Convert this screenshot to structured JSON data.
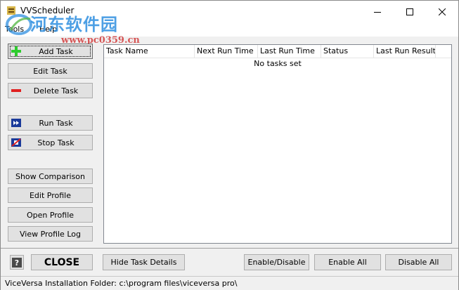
{
  "window": {
    "title": "VVScheduler",
    "controls": {
      "minimize": "—",
      "maximize": "☐",
      "close": "✕"
    }
  },
  "watermark": {
    "text_cn": "河东软件园",
    "url": "www.pc0359.cn"
  },
  "menu": [
    {
      "label": "Tools"
    },
    {
      "label": "Help"
    }
  ],
  "left_buttons": {
    "add_task": "Add Task",
    "edit_task": "Edit Task",
    "delete_task": "Delete Task",
    "run_task": "Run Task",
    "stop_task": "Stop Task",
    "show_comparison": "Show Comparison",
    "edit_profile": "Edit Profile",
    "open_profile": "Open Profile",
    "view_profile_log": "View Profile Log"
  },
  "task_list": {
    "columns": [
      "Task Name",
      "Next Run Time",
      "Last Run Time",
      "Status",
      "Last Run Result"
    ],
    "empty_message": "No tasks set"
  },
  "bottom_bar": {
    "help": "?",
    "close": "CLOSE",
    "hide_task_details": "Hide Task Details",
    "enable_disable": "Enable/Disable",
    "enable_all": "Enable All",
    "disable_all": "Disable All"
  },
  "status_bar": {
    "text": "ViceVersa Installation Folder:  c:\\program files\\viceversa pro\\"
  },
  "icons": {
    "add": "plus-icon",
    "delete": "minus-icon",
    "run": "fast-forward-icon",
    "stop": "stop-icon",
    "help": "question-icon"
  },
  "colors": {
    "add_icon": "#2ecc2e",
    "delete_icon": "#e02020",
    "run_icon_bg": "#1a3a9a",
    "stop_icon_bg": "#1a3a9a",
    "watermark_blue": "#2f8fe0",
    "watermark_red": "#d23c3c"
  }
}
